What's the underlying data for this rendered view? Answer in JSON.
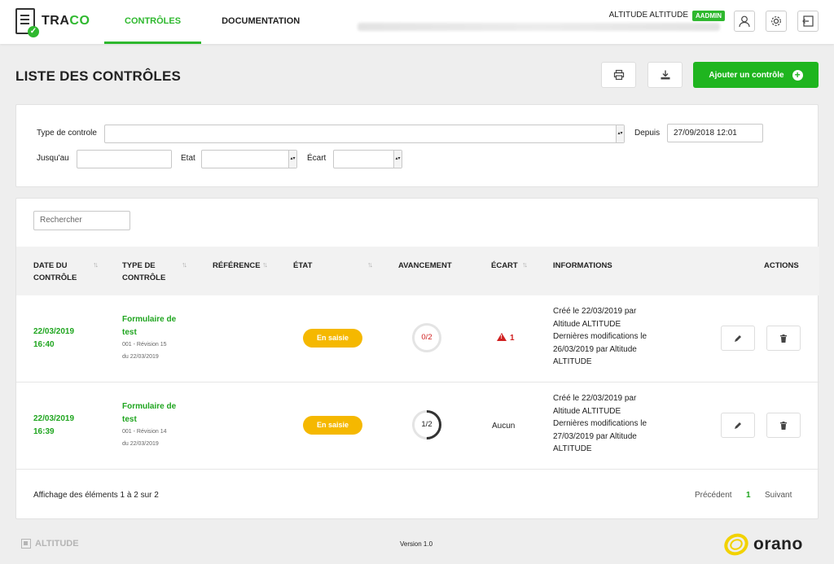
{
  "app": {
    "logo_text_main": "TRA",
    "logo_text_accent": "CO"
  },
  "nav": {
    "items": [
      {
        "label": "CONTRÔLES"
      },
      {
        "label": "DOCUMENTATION"
      }
    ]
  },
  "user": {
    "name": "ALTITUDE ALTITUDE",
    "badge": "AADMIN"
  },
  "page": {
    "title": "LISTE DES CONTRÔLES",
    "add_label": "Ajouter un contrôle"
  },
  "filters": {
    "type_label": "Type de controle",
    "type_value": "",
    "depuis_label": "Depuis",
    "depuis_value": "27/09/2018 12:01",
    "jusquau_label": "Jusqu'au",
    "jusquau_value": "",
    "etat_label": "Etat",
    "etat_value": "",
    "ecart_label": "Écart",
    "ecart_value": ""
  },
  "table": {
    "search_placeholder": "Rechercher",
    "headers": {
      "date_line1": "DATE DU",
      "date_line2": "CONTRÔLE",
      "type_line1": "TYPE DE",
      "type_line2": "CONTRÔLE",
      "reference": "RÉFÉRENCE",
      "etat": "ÉTAT",
      "avancement": "AVANCEMENT",
      "ecart": "ÉCART",
      "informations": "INFORMATIONS",
      "actions": "ACTIONS"
    },
    "rows": [
      {
        "date": "22/03/2019",
        "time": "16:40",
        "type_name_1": "Formulaire de",
        "type_name_2": "test",
        "type_sub_1": "001 - Révision 15",
        "type_sub_2": "du 22/03/2019",
        "etat": "En saisie",
        "avancement": "0/2",
        "progress": 0,
        "ecart": "1",
        "info": [
          "Créé le 22/03/2019 par",
          "Altitude ALTITUDE",
          "Dernières modifications le",
          "26/03/2019 par Altitude",
          "ALTITUDE"
        ]
      },
      {
        "date": "22/03/2019",
        "time": "16:39",
        "type_name_1": "Formulaire de",
        "type_name_2": "test",
        "type_sub_1": "001 - Révision 14",
        "type_sub_2": "du 22/03/2019",
        "etat": "En saisie",
        "avancement": "1/2",
        "progress": 0.5,
        "ecart": "Aucun",
        "info": [
          "Créé le 22/03/2019 par",
          "Altitude ALTITUDE",
          "Dernières modifications le",
          "27/03/2019 par Altitude",
          "ALTITUDE"
        ]
      }
    ],
    "footer_info": "Affichage des éléments 1 à 2 sur 2",
    "pager": {
      "prev": "Précédent",
      "current": "1",
      "next": "Suivant"
    }
  },
  "footer": {
    "brand_left": "ALTITUDE",
    "version": "Version 1.0",
    "brand_right": "orano"
  },
  "colors": {
    "accent": "#1fb51f",
    "status_pill": "#f5b800",
    "alert": "#d02020"
  },
  "icons": [
    "user-icon",
    "gear-icon",
    "logout-icon",
    "print-icon",
    "download-icon",
    "plus-circle-icon",
    "pencil-icon",
    "trash-icon",
    "warning-icon"
  ]
}
